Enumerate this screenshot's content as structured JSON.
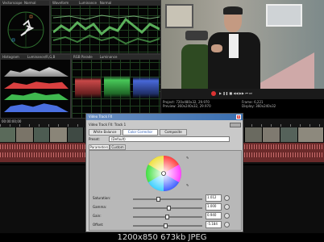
{
  "scopes": {
    "vectorscope": "Vectorscope",
    "normal_1": "Normal",
    "waveform": "Waveform",
    "luminance_1": "Luminance",
    "normal_2": "Normal",
    "histogram": "Histogram",
    "luminance_rgb": "Luminance/R,G,B",
    "rgb_parade": "RGB Parade",
    "luminance_2": "Luminance"
  },
  "preview": {
    "project": "Project:",
    "project_value": "720x480x32, 29.970",
    "preview_label": "Preview:",
    "preview_value": "360x240x32, 29.970",
    "frame_label": "Frame:",
    "frame_value": "6,221",
    "display_label": "Display:",
    "display_value": "360x240x32"
  },
  "timeline": {
    "timecode": "00:00:00;00"
  },
  "fx_window": {
    "title": "Video Track FX",
    "track_label": "Video Track FX:",
    "track_value": "Track 1",
    "chain": [
      "White Balance",
      "Color Corrector",
      "Composite"
    ],
    "preset_label": "Preset:",
    "preset_value": "(Default)",
    "tabs": [
      "Parameters",
      "Custom"
    ],
    "params": [
      {
        "label": "Saturation:",
        "value": "1.012",
        "pos": 0.34
      },
      {
        "label": "Gamma:",
        "value": "1.000",
        "pos": 0.5
      },
      {
        "label": "Gain:",
        "value": "0.940",
        "pos": 0.47
      },
      {
        "label": "Offset:",
        "value": "-5.184",
        "pos": 0.45
      }
    ]
  },
  "caption": "1200x850  673kb  JPEG",
  "colors": {
    "accent": "#3a6fb0",
    "scope_green": "#5fc85f",
    "track_red": "#6b2a2a"
  }
}
